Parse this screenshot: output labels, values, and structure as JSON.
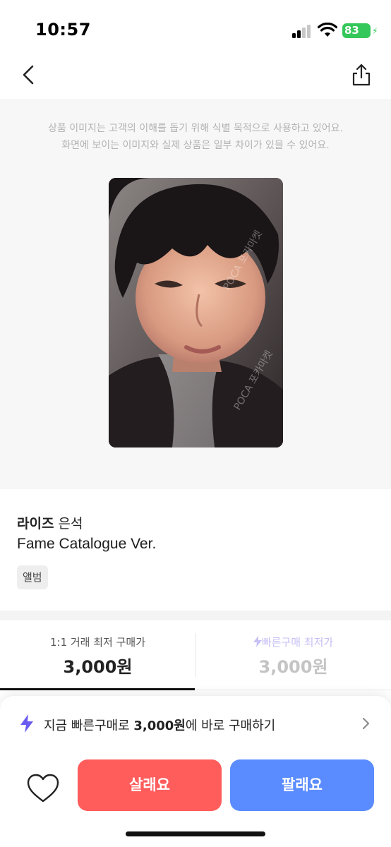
{
  "status_bar": {
    "time": "10:57",
    "battery": "83"
  },
  "notice": {
    "line1": "상품 이미지는 고객의 이해를 돕기 위해 식별 목적으로 사용하고 있어요.",
    "line2": "화면에 보이는 이미지와 실제 상품은 일부 차이가 있을 수 있어요."
  },
  "product": {
    "group": "라이즈",
    "member": "은석",
    "name": "Fame Catalogue Ver.",
    "tag": "앨범",
    "photo_watermark": "POCA 포카마켓"
  },
  "price_tabs": [
    {
      "label": "1:1 거래 최저 구매가",
      "value": "3,000원",
      "active": true
    },
    {
      "label": "빠른구매 최저가",
      "value": "3,000원",
      "active": false
    }
  ],
  "quick_buy": {
    "prefix": "지금 빠른구매로 ",
    "price": "3,000원",
    "suffix": "에 바로 구매하기"
  },
  "actions": {
    "buy": "살래요",
    "sell": "팔래요"
  },
  "colors": {
    "buy": "#ff5c5c",
    "sell": "#5b8cff",
    "bolt_active": "#6b5cf0",
    "bolt_inactive": "#c6bff5"
  },
  "icons": [
    "back-chevron-icon",
    "share-icon",
    "lightning-icon",
    "chevron-right-icon",
    "heart-icon",
    "signal-icon",
    "wifi-icon",
    "battery-icon"
  ]
}
